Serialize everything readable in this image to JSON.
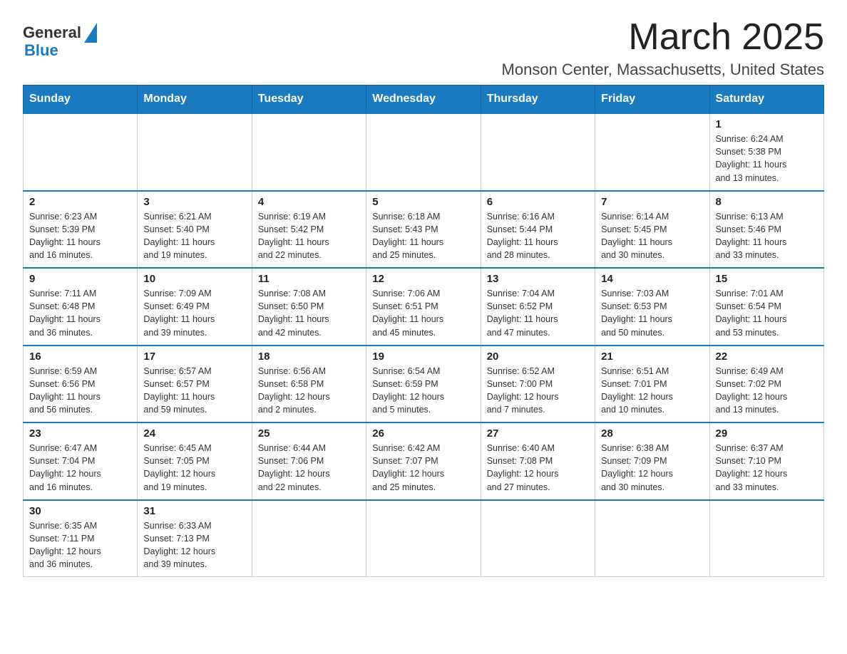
{
  "header": {
    "logo_general": "General",
    "logo_blue": "Blue",
    "month_title": "March 2025",
    "location": "Monson Center, Massachusetts, United States"
  },
  "weekdays": [
    "Sunday",
    "Monday",
    "Tuesday",
    "Wednesday",
    "Thursday",
    "Friday",
    "Saturday"
  ],
  "weeks": [
    [
      {
        "day": "",
        "info": ""
      },
      {
        "day": "",
        "info": ""
      },
      {
        "day": "",
        "info": ""
      },
      {
        "day": "",
        "info": ""
      },
      {
        "day": "",
        "info": ""
      },
      {
        "day": "",
        "info": ""
      },
      {
        "day": "1",
        "info": "Sunrise: 6:24 AM\nSunset: 5:38 PM\nDaylight: 11 hours\nand 13 minutes."
      }
    ],
    [
      {
        "day": "2",
        "info": "Sunrise: 6:23 AM\nSunset: 5:39 PM\nDaylight: 11 hours\nand 16 minutes."
      },
      {
        "day": "3",
        "info": "Sunrise: 6:21 AM\nSunset: 5:40 PM\nDaylight: 11 hours\nand 19 minutes."
      },
      {
        "day": "4",
        "info": "Sunrise: 6:19 AM\nSunset: 5:42 PM\nDaylight: 11 hours\nand 22 minutes."
      },
      {
        "day": "5",
        "info": "Sunrise: 6:18 AM\nSunset: 5:43 PM\nDaylight: 11 hours\nand 25 minutes."
      },
      {
        "day": "6",
        "info": "Sunrise: 6:16 AM\nSunset: 5:44 PM\nDaylight: 11 hours\nand 28 minutes."
      },
      {
        "day": "7",
        "info": "Sunrise: 6:14 AM\nSunset: 5:45 PM\nDaylight: 11 hours\nand 30 minutes."
      },
      {
        "day": "8",
        "info": "Sunrise: 6:13 AM\nSunset: 5:46 PM\nDaylight: 11 hours\nand 33 minutes."
      }
    ],
    [
      {
        "day": "9",
        "info": "Sunrise: 7:11 AM\nSunset: 6:48 PM\nDaylight: 11 hours\nand 36 minutes."
      },
      {
        "day": "10",
        "info": "Sunrise: 7:09 AM\nSunset: 6:49 PM\nDaylight: 11 hours\nand 39 minutes."
      },
      {
        "day": "11",
        "info": "Sunrise: 7:08 AM\nSunset: 6:50 PM\nDaylight: 11 hours\nand 42 minutes."
      },
      {
        "day": "12",
        "info": "Sunrise: 7:06 AM\nSunset: 6:51 PM\nDaylight: 11 hours\nand 45 minutes."
      },
      {
        "day": "13",
        "info": "Sunrise: 7:04 AM\nSunset: 6:52 PM\nDaylight: 11 hours\nand 47 minutes."
      },
      {
        "day": "14",
        "info": "Sunrise: 7:03 AM\nSunset: 6:53 PM\nDaylight: 11 hours\nand 50 minutes."
      },
      {
        "day": "15",
        "info": "Sunrise: 7:01 AM\nSunset: 6:54 PM\nDaylight: 11 hours\nand 53 minutes."
      }
    ],
    [
      {
        "day": "16",
        "info": "Sunrise: 6:59 AM\nSunset: 6:56 PM\nDaylight: 11 hours\nand 56 minutes."
      },
      {
        "day": "17",
        "info": "Sunrise: 6:57 AM\nSunset: 6:57 PM\nDaylight: 11 hours\nand 59 minutes."
      },
      {
        "day": "18",
        "info": "Sunrise: 6:56 AM\nSunset: 6:58 PM\nDaylight: 12 hours\nand 2 minutes."
      },
      {
        "day": "19",
        "info": "Sunrise: 6:54 AM\nSunset: 6:59 PM\nDaylight: 12 hours\nand 5 minutes."
      },
      {
        "day": "20",
        "info": "Sunrise: 6:52 AM\nSunset: 7:00 PM\nDaylight: 12 hours\nand 7 minutes."
      },
      {
        "day": "21",
        "info": "Sunrise: 6:51 AM\nSunset: 7:01 PM\nDaylight: 12 hours\nand 10 minutes."
      },
      {
        "day": "22",
        "info": "Sunrise: 6:49 AM\nSunset: 7:02 PM\nDaylight: 12 hours\nand 13 minutes."
      }
    ],
    [
      {
        "day": "23",
        "info": "Sunrise: 6:47 AM\nSunset: 7:04 PM\nDaylight: 12 hours\nand 16 minutes."
      },
      {
        "day": "24",
        "info": "Sunrise: 6:45 AM\nSunset: 7:05 PM\nDaylight: 12 hours\nand 19 minutes."
      },
      {
        "day": "25",
        "info": "Sunrise: 6:44 AM\nSunset: 7:06 PM\nDaylight: 12 hours\nand 22 minutes."
      },
      {
        "day": "26",
        "info": "Sunrise: 6:42 AM\nSunset: 7:07 PM\nDaylight: 12 hours\nand 25 minutes."
      },
      {
        "day": "27",
        "info": "Sunrise: 6:40 AM\nSunset: 7:08 PM\nDaylight: 12 hours\nand 27 minutes."
      },
      {
        "day": "28",
        "info": "Sunrise: 6:38 AM\nSunset: 7:09 PM\nDaylight: 12 hours\nand 30 minutes."
      },
      {
        "day": "29",
        "info": "Sunrise: 6:37 AM\nSunset: 7:10 PM\nDaylight: 12 hours\nand 33 minutes."
      }
    ],
    [
      {
        "day": "30",
        "info": "Sunrise: 6:35 AM\nSunset: 7:11 PM\nDaylight: 12 hours\nand 36 minutes."
      },
      {
        "day": "31",
        "info": "Sunrise: 6:33 AM\nSunset: 7:13 PM\nDaylight: 12 hours\nand 39 minutes."
      },
      {
        "day": "",
        "info": ""
      },
      {
        "day": "",
        "info": ""
      },
      {
        "day": "",
        "info": ""
      },
      {
        "day": "",
        "info": ""
      },
      {
        "day": "",
        "info": ""
      }
    ]
  ]
}
